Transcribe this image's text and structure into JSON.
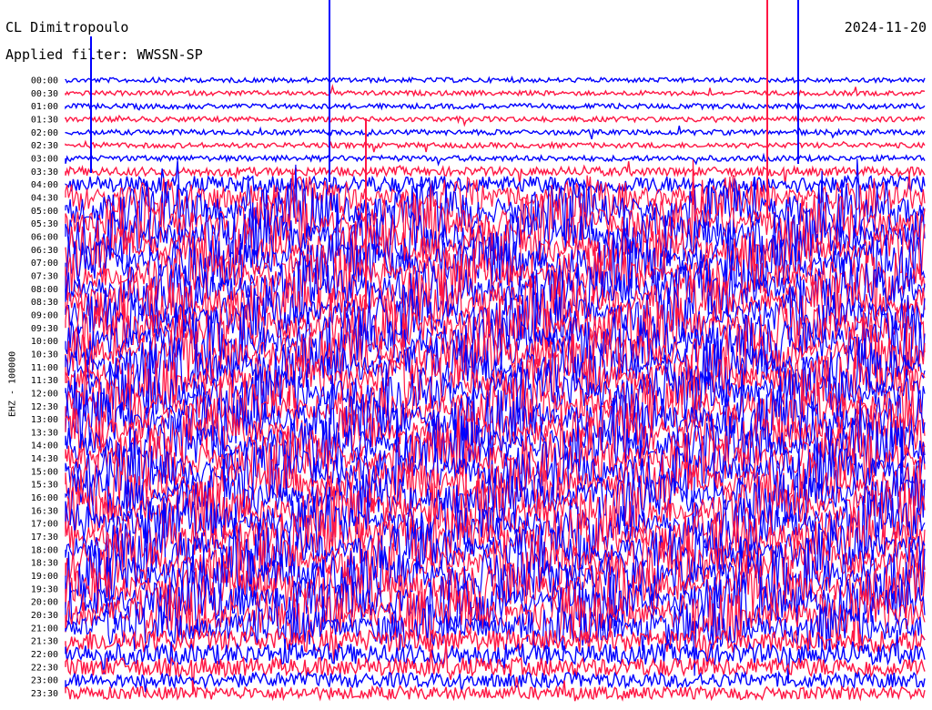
{
  "header": {
    "station": "CL Dimitropoulo",
    "date": "2024-11-20",
    "filter": "Applied filter: WWSSN-SP"
  },
  "chart_data": {
    "type": "line",
    "title": "CL Dimitropoulo",
    "ylabel": "EHZ - 100000",
    "times": [
      "00:00",
      "00:30",
      "01:00",
      "01:30",
      "02:00",
      "02:30",
      "03:00",
      "03:30",
      "04:00",
      "04:30",
      "05:00",
      "05:30",
      "06:00",
      "06:30",
      "07:00",
      "07:30",
      "08:00",
      "08:30",
      "09:00",
      "09:30",
      "10:00",
      "10:30",
      "11:00",
      "11:30",
      "12:00",
      "12:30",
      "13:00",
      "13:30",
      "14:00",
      "14:30",
      "15:00",
      "15:30",
      "16:00",
      "16:30",
      "17:00",
      "17:30",
      "18:00",
      "18:30",
      "19:00",
      "19:30",
      "20:00",
      "20:30",
      "21:00",
      "21:30",
      "22:00",
      "22:30",
      "23:00",
      "23:30"
    ],
    "trace_colors": [
      "#0000ff",
      "#ff1744"
    ],
    "noise_level": [
      0.05,
      0.05,
      0.06,
      0.06,
      0.06,
      0.06,
      0.07,
      0.15,
      0.35,
      0.7,
      1.0,
      1.0,
      1.0,
      1.0,
      1.0,
      1.0,
      1.0,
      1.0,
      1.0,
      1.0,
      1.0,
      1.0,
      1.0,
      1.0,
      1.0,
      1.0,
      1.0,
      1.0,
      1.0,
      1.0,
      1.0,
      1.0,
      1.0,
      1.0,
      1.0,
      1.0,
      1.0,
      1.0,
      1.0,
      1.0,
      1.0,
      1.0,
      0.8,
      0.5,
      0.45,
      0.4,
      0.3,
      0.25
    ]
  }
}
